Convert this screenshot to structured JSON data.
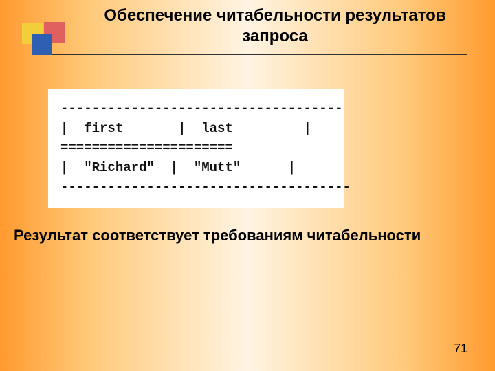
{
  "slide": {
    "title_line1": "Обеспечение читабельности результатов",
    "title_line2": "запроса",
    "caption": "Результат соответствует требованиям читабельности",
    "page_number": "71"
  },
  "code": {
    "rule_top": "------------------------------------",
    "header_row": "|  first       |  last         |",
    "rule_mid": "======================",
    "data_row": "|  \"Richard\"  |  \"Mutt\"      |",
    "rule_bottom": "-------------------------------------"
  },
  "chart_data": {
    "type": "table",
    "columns": [
      "first",
      "last"
    ],
    "rows": [
      {
        "first": "Richard",
        "last": "Mutt"
      }
    ]
  }
}
